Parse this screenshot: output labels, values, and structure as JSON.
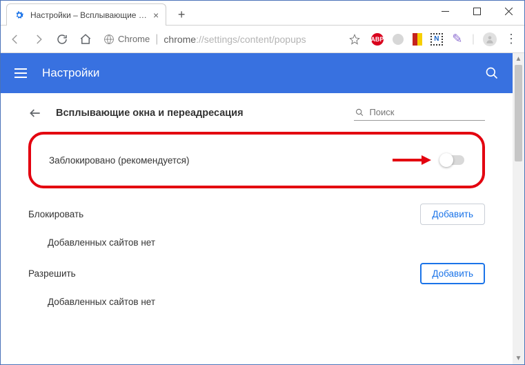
{
  "window": {
    "tab_title": "Настройки – Всплывающие окн",
    "minimize": "—",
    "maximize": "☐",
    "close": "✕"
  },
  "toolbar": {
    "secure_label": "Chrome",
    "url_host": "chrome",
    "url_path": "://settings/content/popups",
    "extensions": {
      "adblock": "ABP",
      "dotted_n": "N"
    }
  },
  "header": {
    "title": "Настройки"
  },
  "subheader": {
    "title": "Всплывающие окна и переадресация",
    "search_placeholder": "Поиск"
  },
  "main_setting": {
    "label": "Заблокировано (рекомендуется)",
    "toggle_on": false
  },
  "sections": {
    "block": {
      "title": "Блокировать",
      "add_label": "Добавить",
      "empty_text": "Добавленных сайтов нет"
    },
    "allow": {
      "title": "Разрешить",
      "add_label": "Добавить",
      "empty_text": "Добавленных сайтов нет"
    }
  }
}
